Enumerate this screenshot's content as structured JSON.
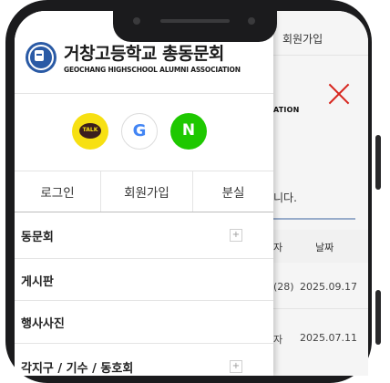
{
  "drawer": {
    "brand": {
      "name_ko": "거창고등학교 총동문회",
      "name_en": "GEOCHANG HIGHSCHOOL ALUMNI ASSOCIATION"
    },
    "social": {
      "kakao_text": "TALK",
      "google_text": "G",
      "naver_text": "N"
    },
    "auth": {
      "login": "로그인",
      "join": "회원가입",
      "lost": "분실"
    },
    "menu": [
      {
        "label": "동문회",
        "expandable": true,
        "plus": "+"
      },
      {
        "label": "게시판",
        "expandable": false
      },
      {
        "label": "행사사진",
        "expandable": false
      },
      {
        "label": "각지구 / 기수 / 동호회",
        "expandable": true,
        "plus": "+"
      }
    ]
  },
  "background_page": {
    "header_join": "회원가입",
    "assoc_fragment": "ATION",
    "notice_fragment": "니다.",
    "table_headers": {
      "writer": "자",
      "date": "날짜"
    },
    "rows": [
      {
        "writer": "(28)",
        "date": "2025.09.17"
      },
      {
        "writer": "자",
        "date": "2025.07.11"
      }
    ]
  },
  "colors": {
    "brand_blue": "#2a5aa5",
    "kakao_yellow": "#f7e012",
    "naver_green": "#1ec800",
    "close_red": "#d7261e",
    "phone_frame": "#1b1b1d"
  }
}
